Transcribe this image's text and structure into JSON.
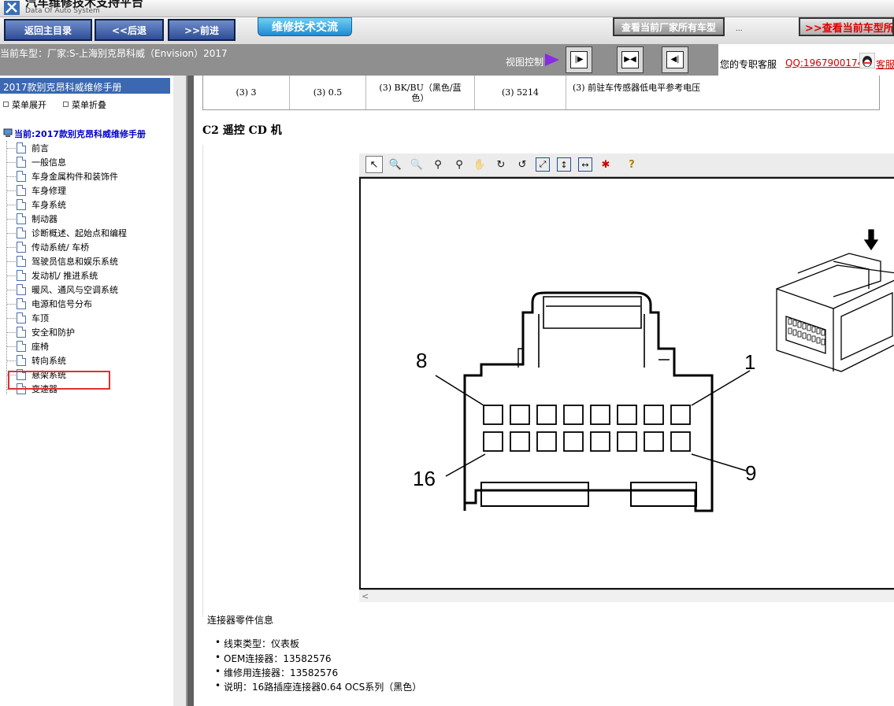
{
  "app": {
    "title": "汽车维修技术支持平台",
    "subtitle": "Data Of Auto System"
  },
  "nav": {
    "home": "返回主目录",
    "back": "<<后退",
    "forward": ">>前进",
    "forum": "维修技术交流",
    "all_cars": "查看当前厂家所有车型",
    "dots": "...",
    "current_model": ">>查看当前车型所"
  },
  "infobar": {
    "current_model": "当前车型：厂家:S-上海别克昂科威（Envision）2017",
    "view_control": "视图控制"
  },
  "service": {
    "label": "您的专职客服",
    "qq": "QQ:1967900174",
    "tail": "客服"
  },
  "sidebar": {
    "title": "2017款别克昂科威维修手册",
    "expand": "菜单展开",
    "collapse": "菜单折叠",
    "current": "当前:2017款别克昂科威维修手册",
    "items": [
      {
        "label": "前言"
      },
      {
        "label": "一般信息"
      },
      {
        "label": "车身金属构件和装饰件"
      },
      {
        "label": "车身修理"
      },
      {
        "label": "车身系统"
      },
      {
        "label": "制动器"
      },
      {
        "label": "诊断概述、起始点和编程"
      },
      {
        "label": "传动系统/ 车桥"
      },
      {
        "label": "驾驶员信息和娱乐系统"
      },
      {
        "label": "发动机/ 推进系统"
      },
      {
        "label": "暖风、通风与空调系统"
      },
      {
        "label": "电源和信号分布"
      },
      {
        "label": "车顶"
      },
      {
        "label": "安全和防护"
      },
      {
        "label": "座椅"
      },
      {
        "label": "转向系统"
      },
      {
        "label": "悬架系统"
      },
      {
        "label": "变速器"
      }
    ]
  },
  "table_row": {
    "pin": "(3) 3",
    "size": "(3) 0.5",
    "color_line1": "(3) BK/BU（黑色/蓝",
    "color_line2": "色）",
    "circuit": "(3) 5214",
    "function": "(3) 前驻车传感器低电平参考电压"
  },
  "section": {
    "title": "C2 遥控 CD 机"
  },
  "diagram": {
    "label_8": "8",
    "label_1": "1",
    "label_16": "16",
    "label_9": "9"
  },
  "connector_info": {
    "title": "连接器零件信息",
    "items": [
      "线束类型：仪表板",
      "OEM连接器：13582576",
      "维修用连接器：13582576",
      "说明：16路插座连接器0.64 OCS系列（黑色）"
    ]
  }
}
